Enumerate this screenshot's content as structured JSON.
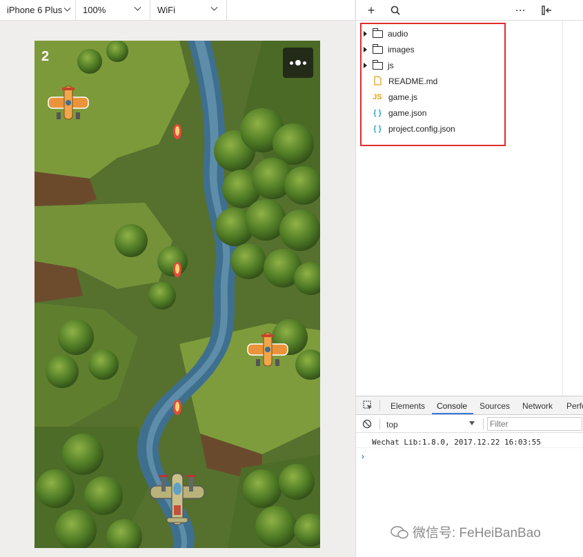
{
  "toolbar": {
    "device": "iPhone 6 Plus",
    "zoom": "100%",
    "network": "WiFi"
  },
  "game": {
    "score": "2"
  },
  "file_tree": {
    "items": [
      {
        "type": "folder",
        "name": "audio"
      },
      {
        "type": "folder",
        "name": "images"
      },
      {
        "type": "folder",
        "name": "js"
      },
      {
        "type": "file",
        "name": "README.md",
        "icon": "markdown-file-icon"
      },
      {
        "type": "file",
        "name": "game.js",
        "icon": "js-file-icon",
        "badge": "JS"
      },
      {
        "type": "file",
        "name": "game.json",
        "icon": "json-file-icon",
        "badge": "{ }"
      },
      {
        "type": "file",
        "name": "project.config.json",
        "icon": "json-file-icon",
        "badge": "{ }"
      }
    ]
  },
  "devtools": {
    "tabs": [
      "Elements",
      "Console",
      "Sources",
      "Network",
      "Perfo"
    ],
    "active_tab": "Console",
    "context": "top",
    "filter_placeholder": "Filter",
    "console_lines": [
      "Wechat Lib:1.8.0, 2017.12.22 16:03:55"
    ]
  },
  "watermark": "微信号: FeHeiBanBao",
  "colors": {
    "highlight_border": "#e02b2b",
    "accent": "#3879d9",
    "js_badge": "#e6a11a",
    "json_badge": "#2aa3d9"
  }
}
